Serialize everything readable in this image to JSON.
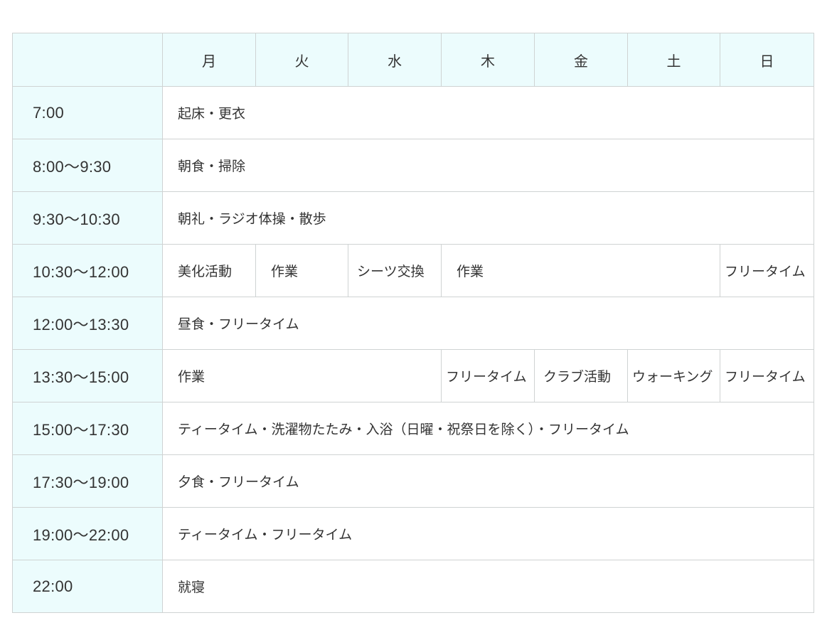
{
  "days": [
    "月",
    "火",
    "水",
    "木",
    "金",
    "土",
    "日"
  ],
  "rows": {
    "r1": {
      "time": "7:00",
      "a": "起床・更衣"
    },
    "r2": {
      "time": "8:00～9:30",
      "a": "朝食・掃除"
    },
    "r3": {
      "time": "9:30～10:30",
      "a": "朝礼・ラジオ体操・散歩"
    },
    "r4": {
      "time": "10:30～12:00",
      "mon": "美化活動",
      "tue": "作業",
      "wed": "シーツ交換",
      "thu_sat": "作業",
      "sun": "フリータイム"
    },
    "r5": {
      "time": "12:00～13:30",
      "a": "昼食・フリータイム"
    },
    "r6": {
      "time": "13:30～15:00",
      "mon_wed": "作業",
      "thu": "フリータイム",
      "fri": "クラブ活動",
      "sat": "ウォーキング",
      "sun": "フリータイム"
    },
    "r7": {
      "time": "15:00～17:30",
      "a": "ティータイム・洗濯物たたみ・入浴（日曜・祝祭日を除く）・フリータイム"
    },
    "r8": {
      "time": "17:30～19:00",
      "a": "夕食・フリータイム"
    },
    "r9": {
      "time": "19:00～22:00",
      "a": "ティータイム・フリータイム"
    },
    "r10": {
      "time": "22:00",
      "a": "就寝"
    }
  }
}
